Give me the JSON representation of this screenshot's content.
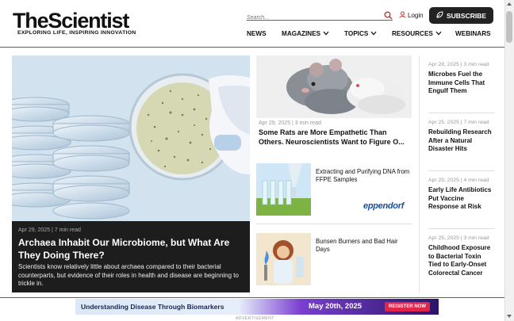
{
  "header": {
    "logo_text": "TheScientist",
    "tagline": "EXPLORING LIFE, INSPIRING INNOVATION",
    "search_placeholder": "Search...",
    "login_label": "Login",
    "subscribe_label": "SUBSCRIBE",
    "nav": [
      "NEWS",
      "MAGAZINES",
      "TOPICS",
      "RESOURCES",
      "WEBINARS"
    ]
  },
  "hero": {
    "meta": "Apr 29, 2025 | 7 min read",
    "title": "Archaea Inhabit Our Microbiome, but What Are They Doing There?",
    "description": "Scientists know relatively little about archaea compared to their bacterial counterparts, but evidence of their roles in health and disease are beginning to trickle in."
  },
  "middle": {
    "meta": "Apr 29, 2025 | 3 min read",
    "title": "Some Rats are More Empathetic Than Others. Neuroscientists Want to Figure O...",
    "sponsored": [
      {
        "title": "Extracting and Purifying DNA from FFPE Samples",
        "brand": "eppendorf"
      },
      {
        "title": "Bunsen Burners and Bad Hair Days"
      }
    ]
  },
  "right": [
    {
      "meta": "Apr 28, 2025 | 3 min read",
      "title": "Microbes Fuel the Immune Cells That Engulf Them"
    },
    {
      "meta": "Apr 25, 2025 | 7 min read",
      "title": "Rebuilding Research After a Natural Disaster Hits"
    },
    {
      "meta": "Apr 25, 2025 | 4 min read",
      "title": "Early Life Antibiotics Put Vaccine Response at Risk"
    },
    {
      "meta": "Apr 25, 2025 | 3 min read",
      "title": "Childhood Exposure to Bacterial Toxin Tied to Early-Onset Colorectal Cancer"
    }
  ],
  "ad": {
    "text": "Understanding Disease Through Biomarkers",
    "date": "May 20th, 2025",
    "button": "REGISTER NOW",
    "label": "ADVERTISEMENT"
  },
  "colors": {
    "accent": "#c0392b",
    "subscribe_bg": "#222222",
    "hero_bg": "#1d1d1d",
    "brand_blue": "#1a4fa1"
  }
}
